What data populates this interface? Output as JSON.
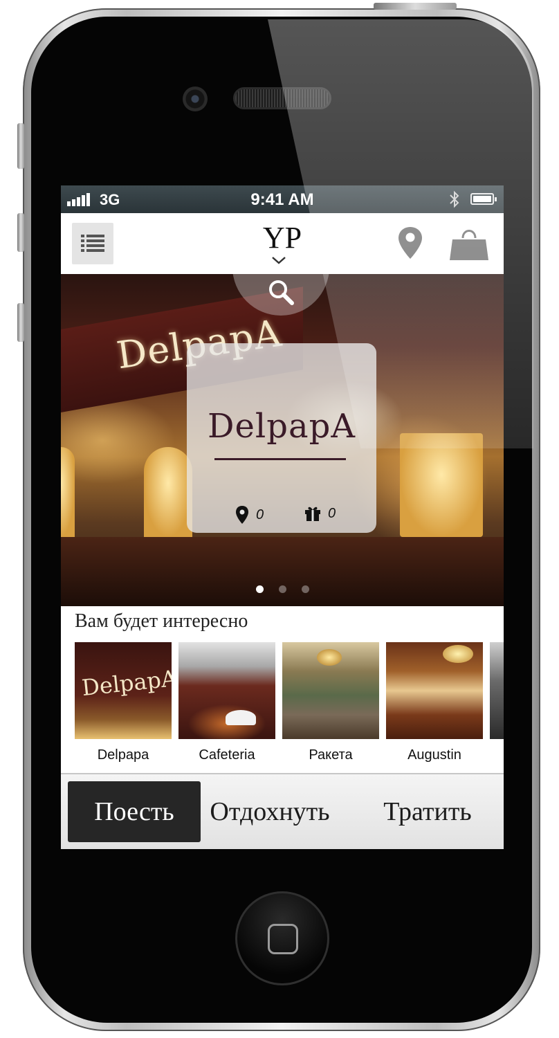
{
  "status_bar": {
    "network": "3G",
    "time": "9:41 AM",
    "signal_bars": 5
  },
  "header": {
    "logo": "YP"
  },
  "hero": {
    "sign_text": "DelpapA",
    "card": {
      "name": "DelpapA",
      "locations_count": "0",
      "gifts_count": "0"
    },
    "slides_total": 3,
    "active_slide": 1
  },
  "recommendations": {
    "title": "Вам будет интересно",
    "items": [
      {
        "name": "Delpapa"
      },
      {
        "name": "Cafeteria"
      },
      {
        "name": "Ракета"
      },
      {
        "name": "Augustin"
      }
    ]
  },
  "tabs": [
    {
      "label": "Поесть",
      "active": true
    },
    {
      "label": "Отдохнуть",
      "active": false
    },
    {
      "label": "Тратить",
      "active": false
    }
  ],
  "icons": {
    "menu": "list-icon",
    "location": "map-pin-icon",
    "cart": "shopping-bag-icon",
    "search": "search-icon",
    "gift": "gift-icon",
    "bluetooth": "bluetooth-icon"
  },
  "colors": {
    "active_tab": "#262626",
    "nav_icons": "#6f6f6f",
    "card_text": "#3a1a28"
  }
}
